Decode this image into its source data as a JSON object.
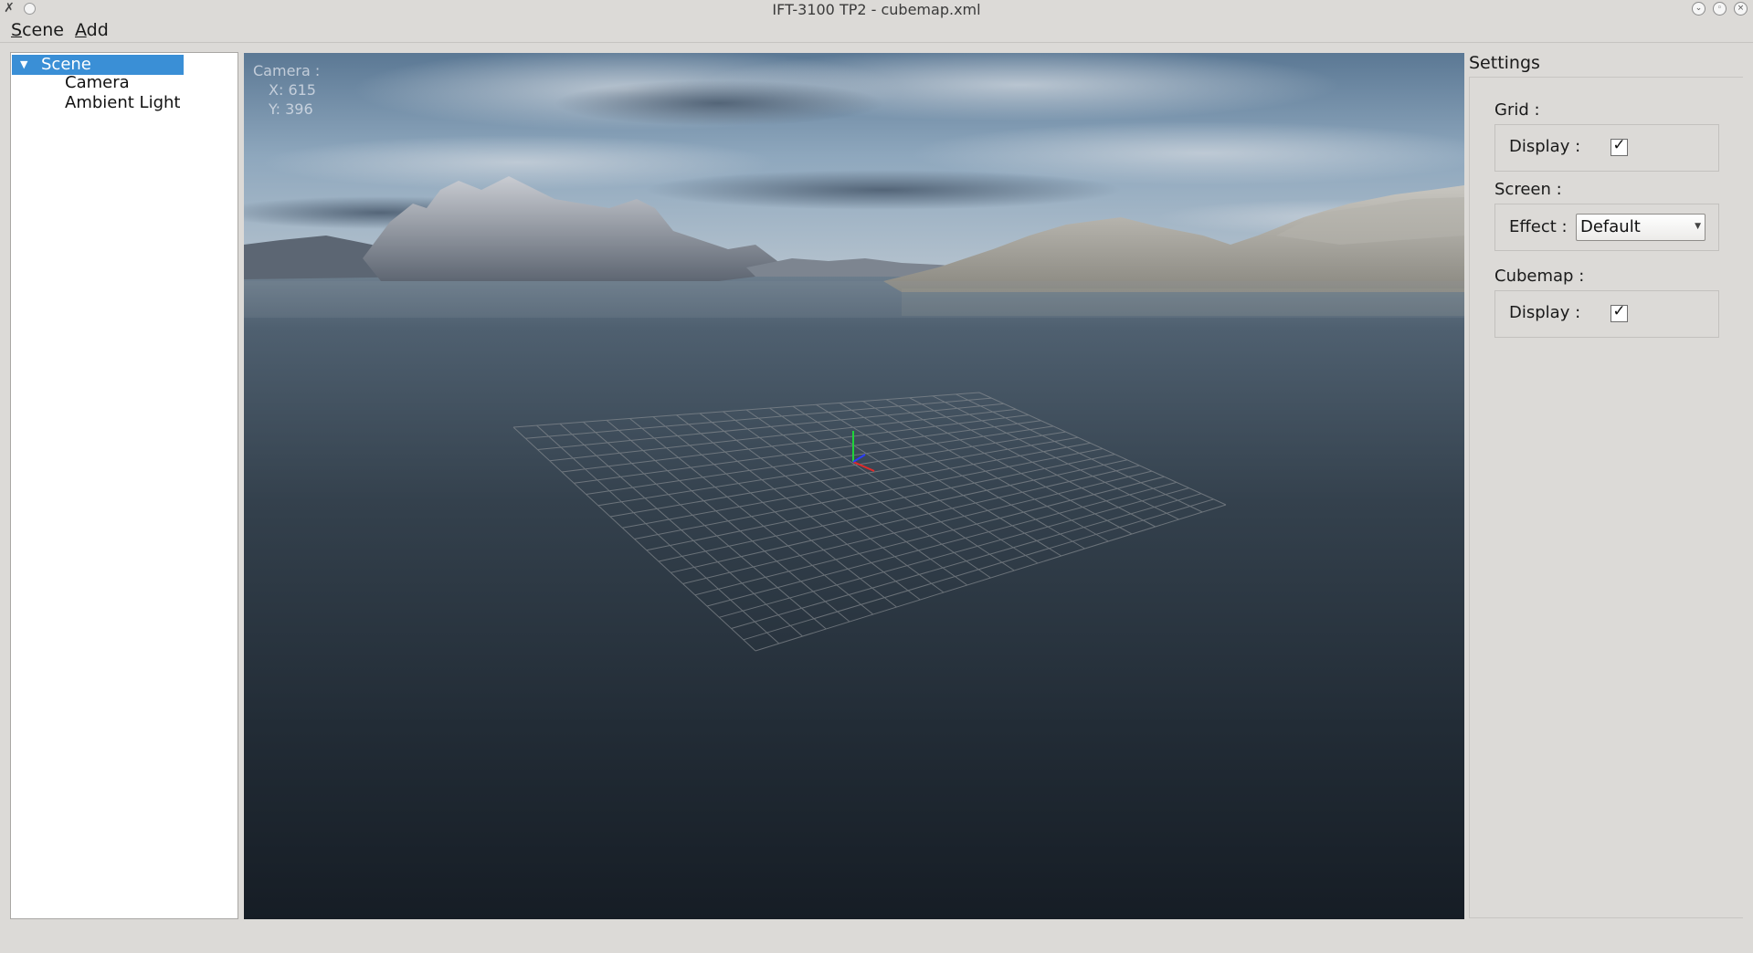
{
  "window": {
    "title": "IFT-3100 TP2 - cubemap.xml",
    "app_icon": "✗",
    "buttons": [
      "minimize-icon",
      "maximize-icon",
      "close-icon"
    ]
  },
  "menu": {
    "items": [
      "Scene",
      "Add"
    ]
  },
  "tree": {
    "root": "Scene",
    "children": [
      "Camera",
      "Ambient Light"
    ]
  },
  "viewport": {
    "camera_label": "Camera :",
    "camera_x": "X: 615",
    "camera_y": "Y: 396"
  },
  "settings": {
    "title": "Settings",
    "grid": {
      "label": "Grid :",
      "display_label": "Display :",
      "display_checked": true
    },
    "screen": {
      "label": "Screen :",
      "effect_label": "Effect :",
      "effect_value": "Default"
    },
    "cubemap": {
      "label": "Cubemap :",
      "display_label": "Display :",
      "display_checked": true
    }
  },
  "colors": {
    "selection": "#3a8fd6",
    "window_bg": "#dcdad7",
    "sky_top": "#6f8ea8",
    "water_deep": "#1a2530"
  }
}
